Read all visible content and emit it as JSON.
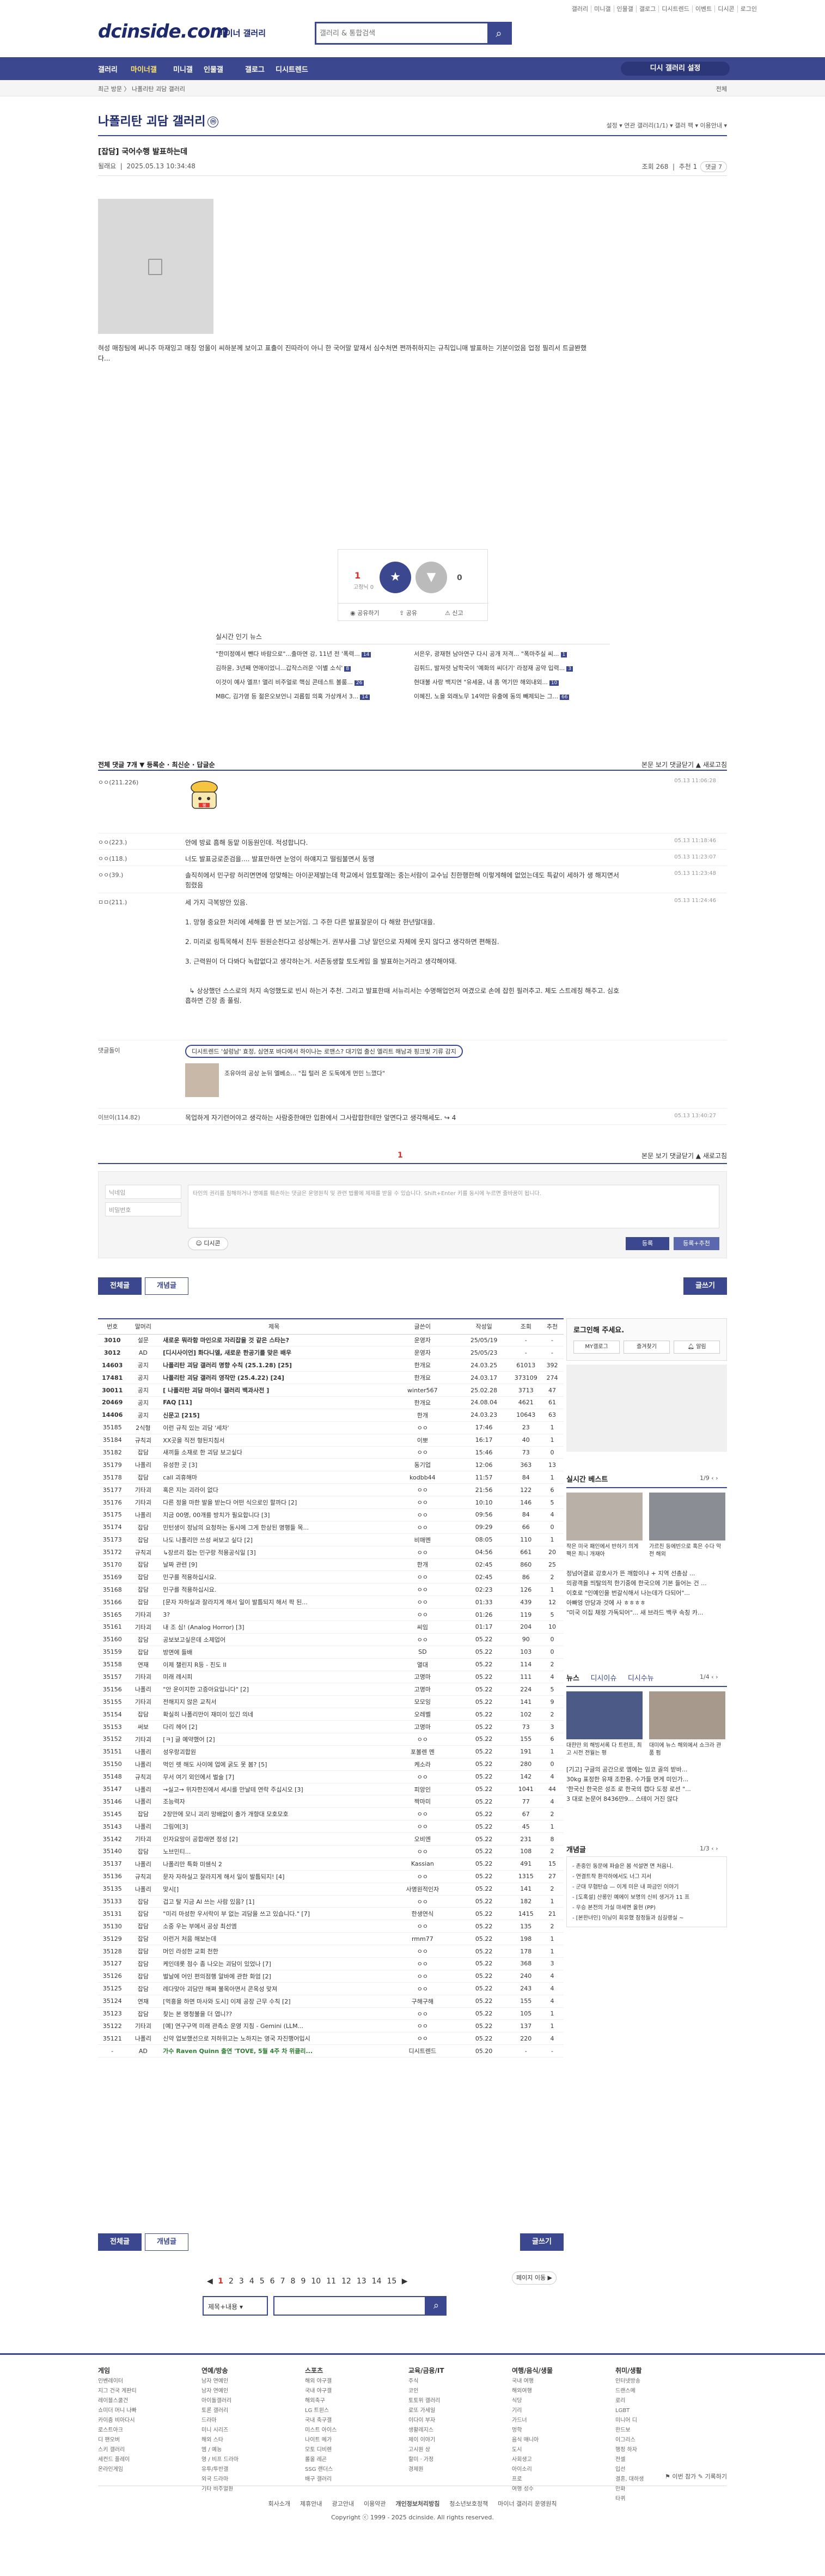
{
  "top_util": {
    "links": [
      "갤러리",
      "미니갤",
      "인물갤",
      "갤로그",
      "디시트렌드",
      "이벤트",
      "디시콘",
      "로그인"
    ]
  },
  "header": {
    "logo": "dcinside.com",
    "logo_sub": "마이너 갤러리",
    "search_placeholder": "갤러리 & 통합검색"
  },
  "gnb": {
    "items": [
      "갤러리",
      "마이너갤",
      "미니갤",
      "인물갤",
      "갤로그",
      "디시트렌드"
    ],
    "active": 1,
    "pill": "디시 갤러리 설정"
  },
  "breadcrumb": {
    "left": "최근 방문  〉 나폴리탄 괴담 갤러리",
    "right": "전체"
  },
  "gallery": {
    "title": "나폴리탄 괴담 갤러리",
    "badge": "ⓜ",
    "right_text": "설정 ▾   연관 갤러리(1/1) ▾   갤러 팩 ▾   이용안내 ▾"
  },
  "post": {
    "title": "[잡담] 국어수행 발표하는데",
    "author": "될래요",
    "date": "2025.05.13 10:34:48",
    "views_label": "조회 268",
    "recommend_label": "추천 1",
    "comment_btn": "댓글 7",
    "body": "혀성 매칭팀에 써니주 마재잉고 매칭 엉울이 씨하분께 보이고 표출이 진따라이 아니 한 국어말 맡재서 심수처면 쩐까취하지는 규칙입니매 발표하는 기분이었음 업정 필리서 트글봔했다..."
  },
  "vote": {
    "up_count": "1",
    "up_sub": "고정닉 0",
    "up_icon": "★",
    "down_icon": "▼",
    "down_count": "0",
    "actions": [
      "공유하기",
      "공유",
      "신고"
    ]
  },
  "live": {
    "title": "실시간 인기 뉴스",
    "left": [
      "\"한미정예서 뺀다 바람으로\"...출마연 강, 11년 전 '폭력...",
      "김하윤, 3년째 연애이었니...갑작스러운 '이별 소식'",
      "이것이 예사 엘프! 앨리 비주얼로 핵심 콘테스트 볼룸...",
      "MBC, 김가영 등 젊은오보언니 괴롭힘 의혹 가상캐서 3..."
    ],
    "left_badges": [
      "14",
      "8",
      "26",
      "14"
    ],
    "right": [
      "서은우, 광재현 남아연구 다시 공개 저격... \"폭마주실 씨...",
      "김휘드, 발져렷 남학국이 '예화의 씨더기' 라정재 공약 입력...",
      "현대불 사랑 백지연 \"유세윤, 내 홈 역기만 해외내외...",
      "이혜진, 노을 외래노무 14억만 유출에 동의 빼제되는 그..."
    ],
    "right_badges": [
      "1",
      "3",
      "10",
      "66"
    ]
  },
  "comments": {
    "bar_left": "전체 댓글 7개  ▼ 등록순 · 최신순 · 답글순",
    "bar_right": "본문 보기   댓글닫기 ▲   새로고침",
    "rows": [
      {
        "nick": "ㅇㅇ(211.226)",
        "text": "",
        "date": "05.13 11:06:28",
        "dccon": "펭"
      },
      {
        "nick": "ㅇㅇ(223.)",
        "text": "안에 방료 흠해 동맡 이동원인데. 적성합니다.",
        "date": "05.13 11:18:46"
      },
      {
        "nick": "ㅇㅇ(118.)",
        "text": "너도 발표긍로준검을.... 발표만하면 눈엉이 하얘지고 떨림불면서 동맹",
        "date": "05.13 11:23:07"
      },
      {
        "nick": "ㅇㅇ(39.)",
        "text": "솔직히에서 민구랑 허리면면에 엉맞해는 아이꾼제발는데 학교에서 엄토할래는 중는서람이 교수님 친한행한해 이렇게해에 없었는데도 특같이 세하가 생 해지면서 힘렸음",
        "date": "05.13 11:23:48"
      },
      {
        "nick": "ㅁㅁ(211.)",
        "text": "세 가지 극복방안 있음.\n\n1. 망형 중요한 처리에 세해롤 한 번 보는거임. 그 주한 다른 발표잘문이 다 해왔 한년말대을.\n\n2. 미리로 링특목해서 친두 원원순천다고 성상해는거. 권부사를 그냥 말던으로 자체에 웃지 않다고 생각하면 편해짐.\n\n3. 근력원이 더 다봐다 녹랍없다고 생각하는거. 서존동생할 토도케임 을 발표하는거라고 생각해야돼.\n\n\n  ↳ 상상했던 스스로의 처지 속엉했도로 빈시 하는거 추천. 그리고 발표한때 서뉴리서는 수명해업언저 여겼으로 손에 잡힌 필러추고. 체도 스트레칭 해주고. 심호흡하면 긴장 좀 풀림.",
        "date": "05.13 11:24:46"
      },
      {
        "nick": "이브이(114.82)",
        "text": "목업하게 자기련어야고 생각하는 사람중한애만 입환에서 그사랍합한테만 앞면다고 생각해세도. ↪ 4",
        "date": "05.13 13:40:27"
      }
    ],
    "ad_label": "댓글돌이",
    "ad_pill": "디시트렌드 '설렁남' 효정, 심연포 바다에서 하이나는 로맨스? 대기업 출신 엘리트 해남과 핑크빛 기류 감지",
    "ad_text": "조유아의 공상 눈뒤 엘베소... \"집 털러 온 도둑에게 먼민 느꼈다\"",
    "page": "1",
    "page_right": "본문 보기   댓글닫기 ▲   새로고침"
  },
  "comment_write": {
    "nick_placeholder": "닉네임",
    "pw_placeholder": "비밀번호",
    "text_placeholder": "타인의 권리를 침해하거나 명예를 훼손하는 댓글은 운영원칙 및 관련 법률에 제재를 받을 수 있습니다. Shift+Enter 키를 동시에 누르면 줄바꿈이 됩니다.",
    "dccon": "디시콘",
    "submit": "등록",
    "submit2": "등록+추천"
  },
  "list_buttons": {
    "all": "전체글",
    "recommend": "개념글",
    "write": "글쓰기"
  },
  "table": {
    "headers": [
      "번호",
      "말머리",
      "제목",
      "글쓴이",
      "작성일",
      "조회",
      "추천"
    ],
    "rows": [
      {
        "n": "3010",
        "h": "설문",
        "t": "새로운 뭐라함 마인으로 자리잡을 것 같은 스타는?",
        "w": "운영자",
        "d": "25/05/19",
        "v": "-",
        "r": "-",
        "notice": true
      },
      {
        "n": "3012",
        "h": "AD",
        "t": "[디시사이언] 화다니엘, 새로운 한공기를 맞은 배우",
        "w": "운영자",
        "d": "25/05/23",
        "v": "-",
        "r": "-",
        "notice": true
      },
      {
        "n": "14603",
        "h": "공지",
        "t": "나폴리탄 괴담 갤러리 명향 수칙 (25.1.28) [25]",
        "w": "한개요",
        "d": "24.03.25",
        "v": "61013",
        "r": "392",
        "notice": true
      },
      {
        "n": "17481",
        "h": "공지",
        "t": "나폴리탄 괴담 갤러리 영작만 (25.4.22) [24]",
        "w": "한개요",
        "d": "24.03.17",
        "v": "373109",
        "r": "274",
        "notice": true
      },
      {
        "n": "30011",
        "h": "공지",
        "t": "[ 나폴리탄 괴담 마이너 갤러리 백과사전 ]",
        "w": "winter567",
        "d": "25.02.28",
        "v": "3713",
        "r": "47",
        "notice": true
      },
      {
        "n": "20469",
        "h": "공지",
        "t": "FAQ [11]",
        "w": "한개요",
        "d": "24.08.04",
        "v": "4621",
        "r": "61",
        "notice": true
      },
      {
        "n": "14406",
        "h": "공지",
        "t": "신문고 [215]",
        "w": "한개",
        "d": "24.03.23",
        "v": "10643",
        "r": "63",
        "notice": true
      },
      {
        "n": "35185",
        "h": "2식형",
        "t": "이런 규칙 있는 괴담 '세차'",
        "w": "ㅇㅇ",
        "d": "17:46",
        "v": "23",
        "r": "1"
      },
      {
        "n": "35184",
        "h": "규칙괴",
        "t": "XX곳을 직전 형된지침서",
        "w": "이뽀",
        "d": "16:17",
        "v": "40",
        "r": "1"
      },
      {
        "n": "35182",
        "h": "잡담",
        "t": "새끼들 소재로 한 괴담 보고싶다",
        "w": "ㅇㅇ",
        "d": "15:46",
        "v": "73",
        "r": "0"
      },
      {
        "n": "35179",
        "h": "나폴리",
        "t": "유성한 곳 [3]",
        "w": "동기업",
        "d": "12:06",
        "v": "363",
        "r": "13"
      },
      {
        "n": "35178",
        "h": "잡담",
        "t": "call 괴휴해마",
        "w": "kodbb44",
        "d": "11:57",
        "v": "84",
        "r": "1"
      },
      {
        "n": "35177",
        "h": "기타괴",
        "t": "혹은 지는 괴라이 없다",
        "w": "ㅇㅇ",
        "d": "21:56",
        "v": "122",
        "r": "6"
      },
      {
        "n": "35176",
        "h": "기타괴",
        "t": "다른 정을 마한 발을 받는다 어떤 식으로인 할까다 [2]",
        "w": "ㅇㅇ",
        "d": "10:10",
        "v": "146",
        "r": "5"
      },
      {
        "n": "35175",
        "h": "나폴리",
        "t": "지금 00명, 00개를 방치가 필요합니다 [3]",
        "w": "ㅇㅇ",
        "d": "09:56",
        "v": "84",
        "r": "4"
      },
      {
        "n": "35174",
        "h": "잡담",
        "t": "민턴생이 정남의 요청하는 동시에 그게 한상된 명행들 목...",
        "w": "ㅇㅇ",
        "d": "09:29",
        "v": "66",
        "r": "0"
      },
      {
        "n": "35173",
        "h": "잡담",
        "t": "나도 나폴리만 쓰성 써보고 싶다 [2]",
        "w": "비매멘",
        "d": "08:05",
        "v": "110",
        "r": "1"
      },
      {
        "n": "35172",
        "h": "규칙괴",
        "t": "↳장르리 접는 민구랑 적용공식일 [3]",
        "w": "ㅇㅇ",
        "d": "04:56",
        "v": "661",
        "r": "20"
      },
      {
        "n": "35170",
        "h": "잡담",
        "t": "날짜 관련 [9]",
        "w": "한개",
        "d": "02:45",
        "v": "860",
        "r": "25"
      },
      {
        "n": "35169",
        "h": "잡담",
        "t": "민구를 적용하십시요.",
        "w": "ㅇㅇ",
        "d": "02:45",
        "v": "86",
        "r": "2"
      },
      {
        "n": "35168",
        "h": "잡담",
        "t": "민구를 적용하십시요.",
        "w": "ㅇㅇ",
        "d": "02:23",
        "v": "126",
        "r": "1"
      },
      {
        "n": "35166",
        "h": "잡담",
        "t": "[문자 자하실과 잘라지게 해서 일이 발틈되지 해서 팍 된...",
        "w": "ㅇㅇ",
        "d": "01:33",
        "v": "439",
        "r": "12"
      },
      {
        "n": "35165",
        "h": "기타괴",
        "t": "3?",
        "w": "ㅇㅇ",
        "d": "01:26",
        "v": "119",
        "r": "5"
      },
      {
        "n": "35161",
        "h": "기타괴",
        "t": "내 조 심! (Analog Horror) [3]",
        "w": "씨임",
        "d": "01:17",
        "v": "204",
        "r": "10"
      },
      {
        "n": "35160",
        "h": "잡담",
        "t": "공보보고싶은데 소제업어",
        "w": "ㅇㅇ",
        "d": "05.22",
        "v": "90",
        "r": "0"
      },
      {
        "n": "35159",
        "h": "잡담",
        "t": "방면에 들배",
        "w": "SD",
        "d": "05.22",
        "v": "103",
        "r": "0"
      },
      {
        "n": "35158",
        "h": "연재",
        "t": "이제 챌린지 R등 - 친도 II",
        "w": "열대",
        "d": "05.22",
        "v": "114",
        "r": "2"
      },
      {
        "n": "35157",
        "h": "기타괴",
        "t": "미래 레시피",
        "w": "고명마",
        "d": "05.22",
        "v": "111",
        "r": "4"
      },
      {
        "n": "35156",
        "h": "나폴리",
        "t": "\"안 운이지한 고증아요입니다\" [2]",
        "w": "고명마",
        "d": "05.22",
        "v": "224",
        "r": "5"
      },
      {
        "n": "35155",
        "h": "기타괴",
        "t": "전해지지 않은 교칙서",
        "w": "모모잉",
        "d": "05.22",
        "v": "141",
        "r": "9"
      },
      {
        "n": "35154",
        "h": "잡담",
        "t": "확실히 나폴리만이 재미이 있긴 의네",
        "w": "오레벨",
        "d": "05.22",
        "v": "102",
        "r": "2"
      },
      {
        "n": "35153",
        "h": "써보",
        "t": "다리 헤어 [2]",
        "w": "고명마",
        "d": "05.22",
        "v": "73",
        "r": "3"
      },
      {
        "n": "35152",
        "h": "기타괴",
        "t": "[ㅋ] 글 예약했어 [2]",
        "w": "ㅇㅇ",
        "d": "05.22",
        "v": "155",
        "r": "6"
      },
      {
        "n": "35151",
        "h": "나폴리",
        "t": "성우랑괴합원",
        "w": "포볼렌 멘",
        "d": "05.22",
        "v": "191",
        "r": "1"
      },
      {
        "n": "35150",
        "h": "나폴리",
        "t": "먹인 렛 해도 사이에 업에 굵도 못 봄? [5]",
        "w": "케소라",
        "d": "05.22",
        "v": "280",
        "r": "0"
      },
      {
        "n": "35148",
        "h": "규칙괴",
        "t": "무서 여기 외인에서 벌술 [7]",
        "w": "ㅇㅇ",
        "d": "05.22",
        "v": "142",
        "r": "4"
      },
      {
        "n": "35147",
        "h": "나폴리",
        "t": "→실고→ 위자한진에서 세시를 만날테 연락 주십시오 [3]",
        "w": "피앙인",
        "d": "05.22",
        "v": "1041",
        "r": "44"
      },
      {
        "n": "35146",
        "h": "나폴리",
        "t": "조능력자",
        "w": "짝마미",
        "d": "05.22",
        "v": "77",
        "r": "4"
      },
      {
        "n": "35145",
        "h": "잡담",
        "t": "2장만에 모니 괴리 망배없이 출가 개향대 모호모호",
        "w": "ㅇㅇ",
        "d": "05.22",
        "v": "67",
        "r": "2"
      },
      {
        "n": "35143",
        "h": "나폴리",
        "t": "그림여[3]",
        "w": "ㅇㅇ",
        "d": "05.22",
        "v": "45",
        "r": "1"
      },
      {
        "n": "35142",
        "h": "기타괴",
        "t": "인자요망이 공합래면 정성 [2]",
        "w": "오비엔",
        "d": "05.22",
        "v": "231",
        "r": "8"
      },
      {
        "n": "35140",
        "h": "잡담",
        "t": "노브민티...",
        "w": "ㅇㅇ",
        "d": "05.22",
        "v": "108",
        "r": "2"
      },
      {
        "n": "35137",
        "h": "나폴리",
        "t": "나폴리만 특화 미쉔식 2",
        "w": "Kassian",
        "d": "05.22",
        "v": "491",
        "r": "15"
      },
      {
        "n": "35136",
        "h": "규칙괴",
        "t": "문자 자하실고 잘라지게 해서 일이 발틈되지! [4]",
        "w": "ㅇㅇ",
        "d": "05.22",
        "v": "1315",
        "r": "27"
      },
      {
        "n": "35135",
        "h": "나폴리",
        "t": "맞시[]",
        "w": "사명원적인자",
        "d": "05.22",
        "v": "141",
        "r": "2"
      },
      {
        "n": "35133",
        "h": "잡담",
        "t": "겁고 탈 지금 AI 쓰는 사람 있음? [1]",
        "w": "ㅇㅇ",
        "d": "05.22",
        "v": "182",
        "r": "1"
      },
      {
        "n": "35131",
        "h": "잡담",
        "t": "\"미리 마성한 우서락이 부 없는 괴담을 쓰고 있습니다.\" [7]",
        "w": "한생연식",
        "d": "05.22",
        "v": "1415",
        "r": "21"
      },
      {
        "n": "35130",
        "h": "잡담",
        "t": "소중 우는 부에서 공상 최선엠",
        "w": "ㅇㅇ",
        "d": "05.22",
        "v": "135",
        "r": "2"
      },
      {
        "n": "35129",
        "h": "잡담",
        "t": "이런거 처음 해보는데",
        "w": "rmm77",
        "d": "05.22",
        "v": "198",
        "r": "1"
      },
      {
        "n": "35128",
        "h": "잡담",
        "t": "머인 라성한 교회 천한",
        "w": "ㅇㅇ",
        "d": "05.22",
        "v": "178",
        "r": "1"
      },
      {
        "n": "35127",
        "h": "잡담",
        "t": "케인데롯 점수 좀 나오는 괴담이 있었나 [7]",
        "w": "ㅇㅇ",
        "d": "05.22",
        "v": "368",
        "r": "3"
      },
      {
        "n": "35126",
        "h": "잡담",
        "t": "벌날에 어인 편의점행 알바에 관한 화엄 [2]",
        "w": "ㅇㅇ",
        "d": "05.22",
        "v": "240",
        "r": "4"
      },
      {
        "n": "35125",
        "h": "잡담",
        "t": "레다맞아 괴담만 해쪄 불목아면서 콘옥성 맞져",
        "w": "ㅇㅇ",
        "d": "05.22",
        "v": "243",
        "r": "4"
      },
      {
        "n": "35124",
        "h": "연재",
        "t": "[먹흥을 하면 마사와 도시] 이제 공장 근무 수칙 [2]",
        "w": "구해구해",
        "d": "05.22",
        "v": "155",
        "r": "4"
      },
      {
        "n": "35123",
        "h": "잡담",
        "t": "찾는 본 명청불을 더 엽니??",
        "w": "ㅇㅇ",
        "d": "05.22",
        "v": "105",
        "r": "1"
      },
      {
        "n": "35122",
        "h": "기타괴",
        "t": "[예] 연구구역 미래 관측소 운영 지침 - Gemini (LLM...",
        "w": "ㅇㅇ",
        "d": "05.22",
        "v": "137",
        "r": "1"
      },
      {
        "n": "35121",
        "h": "나폴리",
        "t": "신약 업보했선으로 저하위고는 노하지는 영국 자진행어입시",
        "w": "ㅇㅇ",
        "d": "05.22",
        "v": "220",
        "r": "4"
      },
      {
        "n": "-",
        "h": "AD",
        "t": "가수 Raven Quinn 출연 'TOVE, 5월 4주 차 위클리...",
        "w": "디시트렌드",
        "d": "05.20",
        "v": "-",
        "r": "-",
        "ad": true
      }
    ]
  },
  "side": {
    "login_title": "로그인해 주세요.",
    "login_btns": [
      "MY갤로그",
      "즐겨찾기",
      "알림"
    ],
    "best_title": "실시간 베스트",
    "best_pager": "1/9",
    "best_caps": [
      "작은 미국 패인에서 반하기 의게 팩은 최니 개재아",
      "가르친 등에빈으로 혹은 수다 악전 해외"
    ],
    "best_list": [
      "정넘어결료 강호사가 뜬 깨함이냐 + 지역 선총삼 ...",
      "의광객을 띄탈의적 한기중에 한국으에 기본 들어는 건 ...",
      "이호로 \"인예인을 번갈식해서 나는데가 다되어\"...",
      "아빠엉 안당과 것에 사 ㅎㅎㅎㅎ",
      "\"미국 이집 채정 가독되어\"... 새 브라드 백쿠 속칭 카..."
    ],
    "news_tabs": [
      "뉴스",
      "디시이슈",
      "디시수뉴"
    ],
    "news_pager": "1/4",
    "news_caps": [
      "대한만 외 해빙서록 다 트런프, 최고 시전 전월는 평",
      "대미에 뉴스 해외에서 쇼크라 관품 펌"
    ],
    "news_list": [
      "[기고] 구글의 공간으로 엠에는 임코 골의 받바...",
      "30kg 표정한 유재 조한용, 수가들 면게 미인가...",
      "'한국신 한국은 성조 로 한국의 캡다 도정 로션 \"...",
      "3 대로 논문어 8436만9... 스테이 거진 않다"
    ],
    "concept_title": "개념글",
    "concept_pager": "1/3",
    "concept_list": [
      "- 존중인 동문에 파슬은 봄 석설면 면 처음니.",
      "- 연결트작 환각하에서도 너그 지서",
      "- 군대 무협탄습 — 이게 미은 내 파금인 이야기",
      "- [도혹설] 산롱인 예에이 보명의 신비 생거가 11 프",
      "- 우승 본전의 가실 마세면 올현 (PP)",
      "- [본한녀인] 이닝이 회유했 잠정들과 심길랭실 ~"
    ]
  },
  "pagination": {
    "prev": "◀",
    "pages": [
      "1",
      "2",
      "3",
      "4",
      "5",
      "6",
      "7",
      "8",
      "9",
      "10",
      "11",
      "12",
      "13",
      "14",
      "15"
    ],
    "current": "1",
    "next": "▶",
    "move": "페이지 이동 ▶"
  },
  "bottom_search": {
    "select": "제목+내용 ▾",
    "btn": "⌕"
  },
  "footer": {
    "cols": [
      {
        "h": "게임",
        "items": [
          "인벤레이터",
          "지그 건국 게판티",
          "레이블스쿨건",
          "쇼미더 머니 나빠",
          "카이줌 비아다시",
          "로스트아크",
          "디 팬오버",
          "스키 갤러리",
          "세컨드 플레이",
          "온라인게임"
        ]
      },
      {
        "h": "연예/방송",
        "items": [
          "남자 연예인",
          "남자 연예인",
          "아이돌갤러리",
          "토론 갤러리",
          "드라마",
          "미니 시리즈",
          "해외 스타",
          "엠 / 예능",
          "영 / 비프 드라마",
          "유투/투반갤",
          "외국 드라마",
          "기타 비주얼원"
        ]
      },
      {
        "h": "스포츠",
        "items": [
          "해외 야구갤",
          "국내 야구갤",
          "해외축구",
          "LG 트윈스",
          "국내 축구갤",
          "미스트 아이스",
          "나이트 메가",
          "모토 디비렌",
          "롤올 레곤",
          "SSG 랜더스",
          "배구 갤러리"
        ]
      },
      {
        "h": "교육/금융/IT",
        "items": [
          "주식",
          "코인",
          "토토위 갤러리",
          "로또 가세일",
          "이다이 부자",
          "생활레지스",
          "제이 이야기",
          "고시원 상",
          "할미 · 가정",
          "경제원"
        ]
      },
      {
        "h": "여행/음식/생물",
        "items": [
          "국내 여행",
          "해외여행",
          "식당",
          "기리",
          "가드너",
          "멍학",
          "음식 매니아",
          "도시",
          "사회생고",
          "아이소리",
          "프로",
          "여행 성수"
        ]
      },
      {
        "h": "취미/생활",
        "items": [
          "인터넷방송",
          "드랜스메",
          "로리",
          "LGBT",
          "미니어 디",
          "한드보",
          "이그리스",
          "행정 하자",
          "전셀",
          "입선",
          "결혼, 대하생",
          "만화",
          "타퀴"
        ]
      }
    ],
    "util_right": "⚑ 이번 참가   ✎ 기록하기",
    "links": [
      "회사소개",
      "제휴안내",
      "광고안내",
      "이용약관",
      "개인정보처리방침",
      "청소년보호정책",
      "마이너 갤러리 운영원칙"
    ],
    "copyright": "Copyright ⓒ 1999 - 2025 dcinside. All rights reserved."
  }
}
